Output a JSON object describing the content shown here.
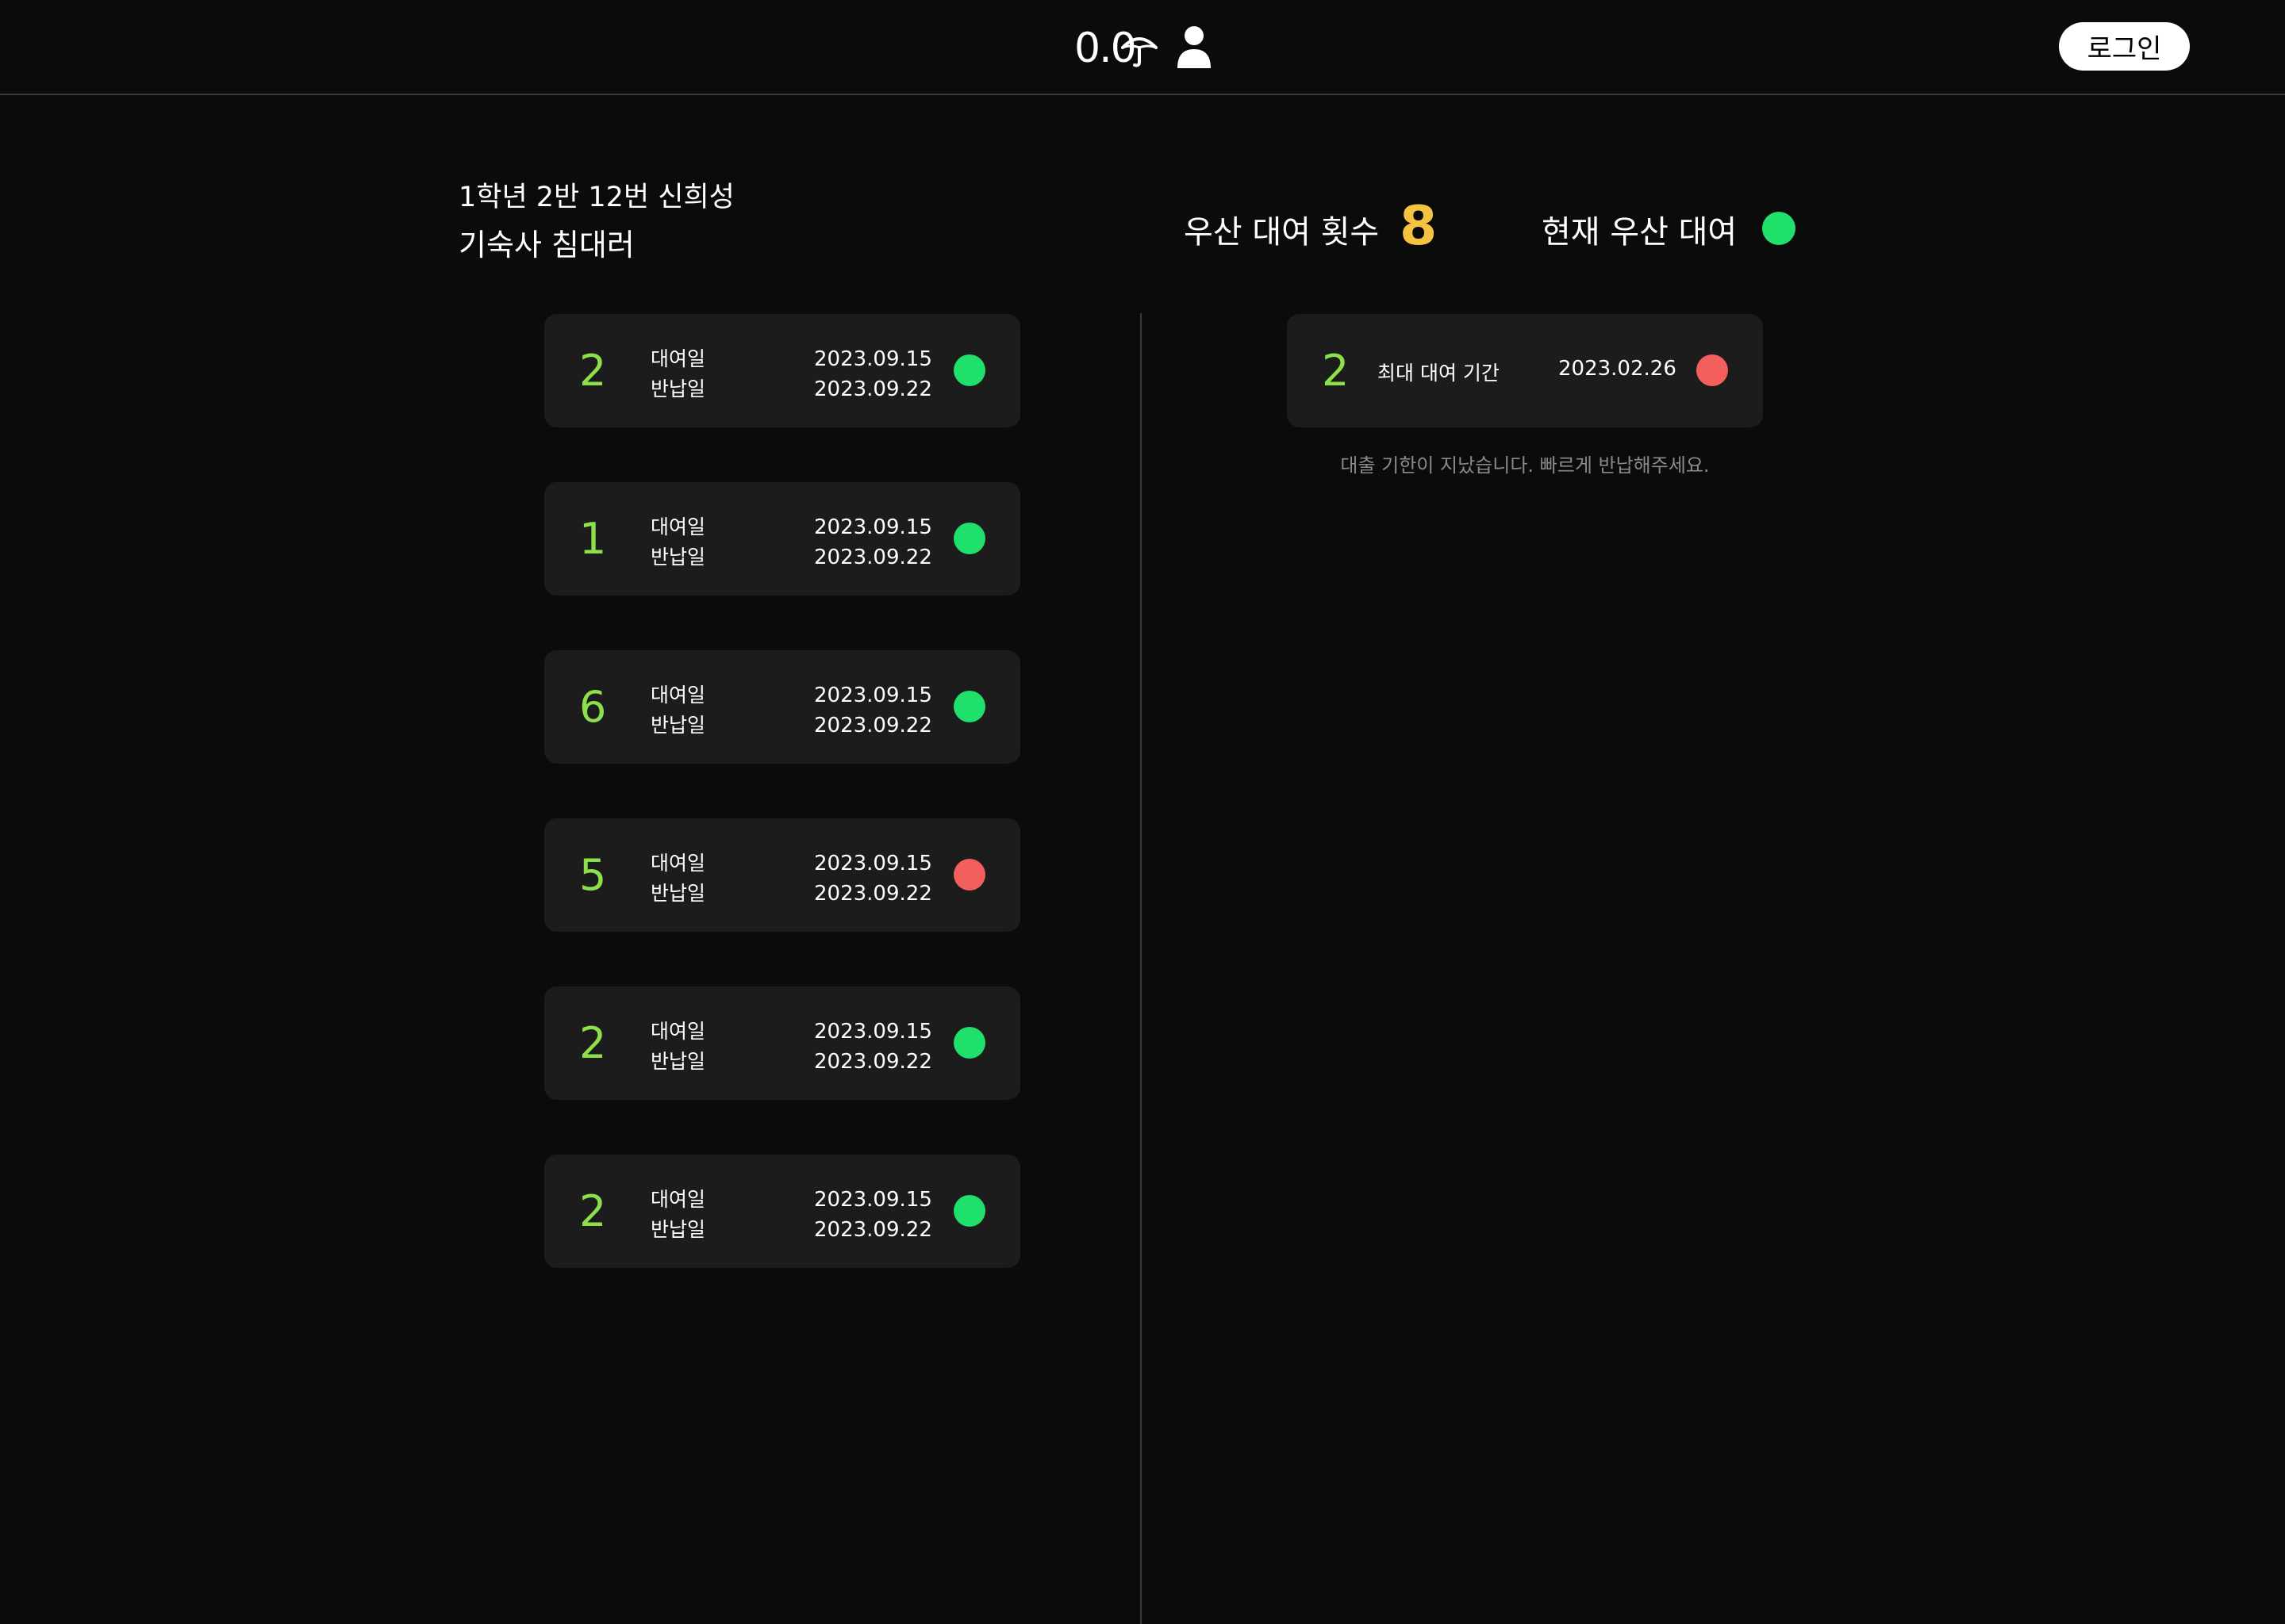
{
  "header": {
    "logo_text": "0.0",
    "login_label": "로그인"
  },
  "student": {
    "info": "1학년 2반 12번 신희성",
    "dorm": "기숙사 침대러"
  },
  "stats": {
    "rent_count_label": "우산 대여 횟수",
    "rent_count": "8",
    "current_rent_label": "현재 우산 대여",
    "current_rent_active": true
  },
  "labels": {
    "rent_date": "대여일",
    "return_date": "반납일"
  },
  "history": [
    {
      "umbrella": "2",
      "rent_date": "2023.09.15",
      "return_date": "2023.09.22",
      "status": "returned"
    },
    {
      "umbrella": "1",
      "rent_date": "2023.09.15",
      "return_date": "2023.09.22",
      "status": "returned"
    },
    {
      "umbrella": "6",
      "rent_date": "2023.09.15",
      "return_date": "2023.09.22",
      "status": "returned"
    },
    {
      "umbrella": "5",
      "rent_date": "2023.09.15",
      "return_date": "2023.09.22",
      "status": "overdue"
    },
    {
      "umbrella": "2",
      "rent_date": "2023.09.15",
      "return_date": "2023.09.22",
      "status": "returned"
    },
    {
      "umbrella": "2",
      "rent_date": "2023.09.15",
      "return_date": "2023.09.22",
      "status": "returned"
    }
  ],
  "current_rental": {
    "umbrella": "2",
    "label": "최대 대여 기간",
    "date": "2023.02.26",
    "status": "overdue",
    "notice": "대출 기한이 지났습니다. 빠르게 반납해주세요."
  },
  "colors": {
    "green": "#1fe06a",
    "red": "#f25f5c",
    "number_green": "#8ee04a",
    "count_yellow": "#f5c342"
  }
}
